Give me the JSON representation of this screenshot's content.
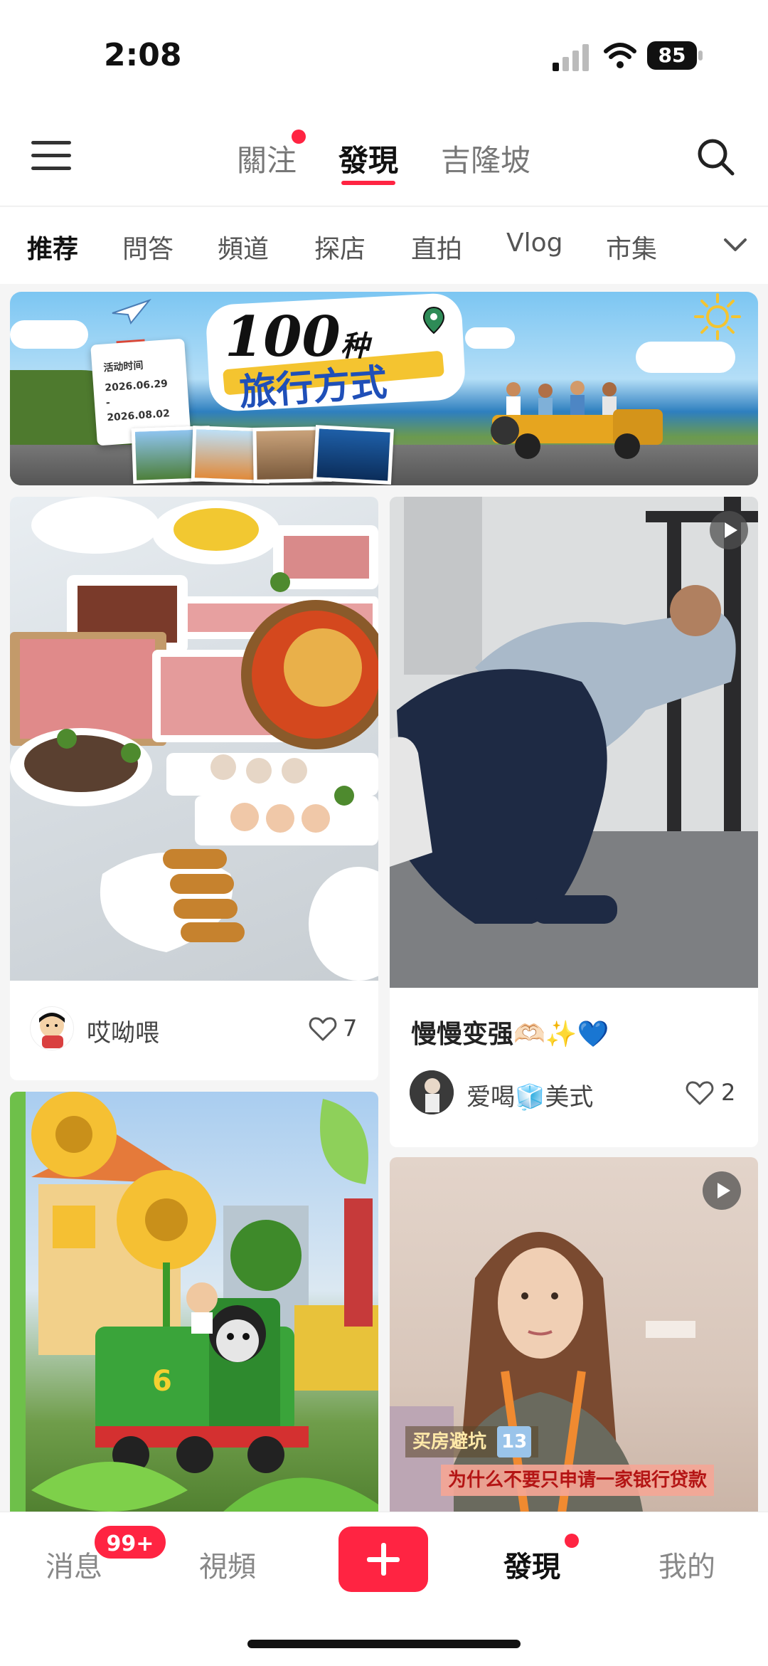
{
  "status_bar": {
    "time": "2:08",
    "battery": "85"
  },
  "top_nav": {
    "tabs": [
      {
        "label": "關注",
        "has_dot": true
      },
      {
        "label": "發現",
        "active": true
      },
      {
        "label": "吉隆坡"
      }
    ],
    "accent_color": "#ff2442"
  },
  "categories": [
    "推荐",
    "問答",
    "頻道",
    "探店",
    "直拍",
    "Vlog",
    "市集"
  ],
  "banner": {
    "title": "100",
    "title_suffix": "种",
    "subtitle": "旅行方式",
    "card_label": "活动时间",
    "date_start": "2026.06.29",
    "date_sep": "-",
    "date_end": "2026.08.02"
  },
  "feed": {
    "left": [
      {
        "author": "哎呦喂",
        "likes": "7",
        "image": "hotpot-spread"
      },
      {
        "image": "sunflower-train-playground"
      }
    ],
    "right": [
      {
        "title": "慢慢变强🫶🏻✨💙",
        "author": "爱喝🧊美式",
        "likes": "2",
        "image": "gym-workout",
        "is_video": true
      },
      {
        "image": "woman-talking-video",
        "is_video": true,
        "caption_tag": "买房避坑",
        "caption_num": "13",
        "caption_text": "为什么不要只申请一家银行贷款"
      }
    ]
  },
  "bottom_bar": {
    "messages": "消息",
    "messages_badge": "99+",
    "videos": "視頻",
    "discover": "發現",
    "me": "我的"
  }
}
